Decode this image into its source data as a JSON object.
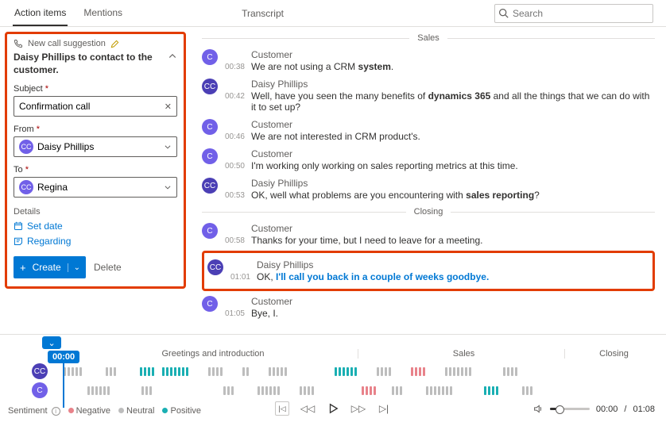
{
  "tabs": {
    "action_items": "Action items",
    "mentions": "Mentions"
  },
  "transcript_label": "Transcript",
  "search": {
    "placeholder": "Search"
  },
  "suggestion": {
    "label": "New call suggestion",
    "title": "Daisy Phillips to contact to the customer.",
    "subject_label": "Subject",
    "subject_value": "Confirmation call",
    "from_label": "From",
    "from_initials": "CC",
    "from_value": "Daisy Phillips",
    "to_label": "To",
    "to_initials": "CC",
    "to_value": "Regina",
    "details_label": "Details",
    "set_date": "Set date",
    "regarding": "Regarding",
    "create": "Create",
    "delete": "Delete"
  },
  "sections": {
    "sales": "Sales",
    "closing": "Closing"
  },
  "transcript": {
    "e1": {
      "ts": "00:38",
      "speaker": "Customer",
      "prefix": "We are not using a CRM ",
      "bold": "system",
      "suffix": "."
    },
    "e2": {
      "ts": "00:42",
      "speaker": "Daisy Phillips",
      "prefix": "Well, have you seen the many benefits of ",
      "bold": "dynamics 365",
      "suffix": " and all the things that we can do with it to set up?"
    },
    "e3": {
      "ts": "00:46",
      "speaker": "Customer",
      "text": "We are not interested in CRM product's."
    },
    "e4": {
      "ts": "00:50",
      "speaker": "Customer",
      "text": "I'm working only working on sales reporting metrics at this time."
    },
    "e5": {
      "ts": "00:53",
      "speaker": "Dasiy Phillips",
      "prefix": "OK, well what problems are you encountering with ",
      "bold": "sales reporting",
      "suffix": "?"
    },
    "e6": {
      "ts": "00:58",
      "speaker": "Customer",
      "text": "Thanks for your time, but I need to leave for a meeting."
    },
    "e7": {
      "ts": "01:01",
      "speaker": "Daisy Phillips",
      "prefix": "OK, ",
      "bold": "I'll call you back in a couple of weeks goodbye.",
      "suffix": ""
    },
    "e8": {
      "ts": "01:05",
      "speaker": "Customer",
      "text": "Bye, I."
    }
  },
  "timeline": {
    "marker_time": "00:00",
    "seg1": "Greetings and introduction",
    "seg2": "Sales",
    "seg3": "Closing",
    "cc_initials": "CC",
    "c_initials": "C"
  },
  "legend": {
    "title": "Sentiment",
    "neg": "Negative",
    "neu": "Neutral",
    "pos": "Positive"
  },
  "player": {
    "current": "00:00",
    "total": "01:08",
    "sep": "/ "
  }
}
